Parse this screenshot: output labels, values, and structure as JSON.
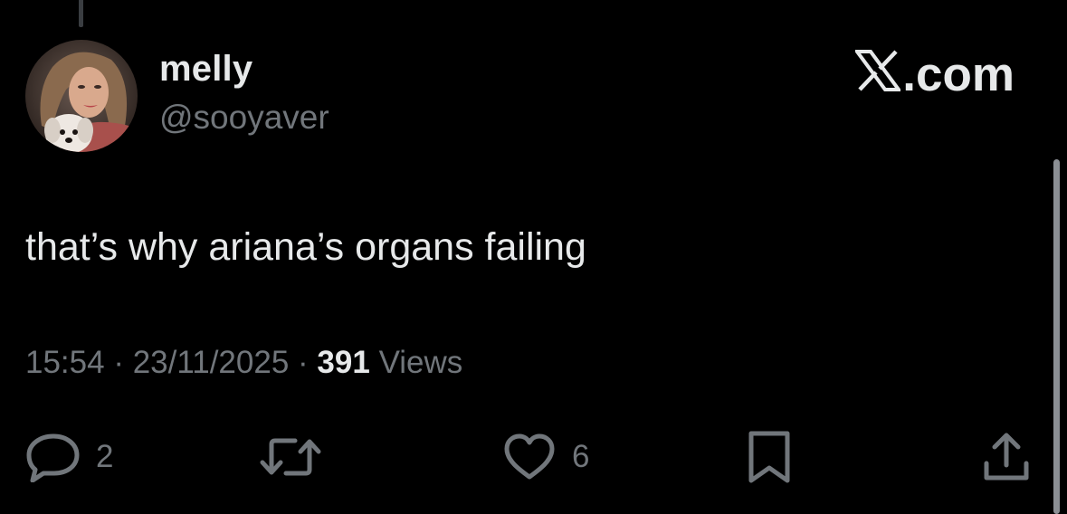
{
  "post": {
    "display_name": "melly",
    "handle": "@sooyaver",
    "text": "that’s why ariana’s organs failing",
    "time": "15:54",
    "date": "23/11/2025",
    "separator": "·",
    "views_count": "391",
    "views_label": "Views"
  },
  "brand": {
    "icon": "x-logo-icon",
    "suffix": ".com"
  },
  "actions": {
    "reply": {
      "icon": "reply-icon",
      "count": "2"
    },
    "repost": {
      "icon": "repost-icon"
    },
    "like": {
      "icon": "heart-icon",
      "count": "6"
    },
    "bookmark": {
      "icon": "bookmark-icon"
    },
    "share": {
      "icon": "share-icon"
    }
  },
  "colors": {
    "background": "#000000",
    "primary_text": "#e7e9ea",
    "secondary_text": "#71767b"
  }
}
